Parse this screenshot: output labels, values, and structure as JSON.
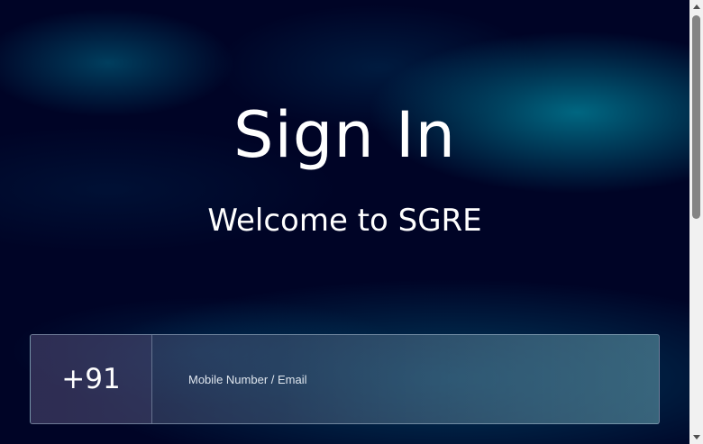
{
  "page": {
    "title": "Sign In",
    "subtitle": "Welcome to SGRE"
  },
  "login": {
    "country_code": "+91",
    "id_placeholder": "Mobile Number / Email",
    "id_value": ""
  },
  "colors": {
    "background": "#000426",
    "glow": "#00788f",
    "text": "#ffffff"
  },
  "scrollbar": {
    "up_icon": "chevron-up-icon",
    "down_icon": "chevron-down-icon"
  }
}
